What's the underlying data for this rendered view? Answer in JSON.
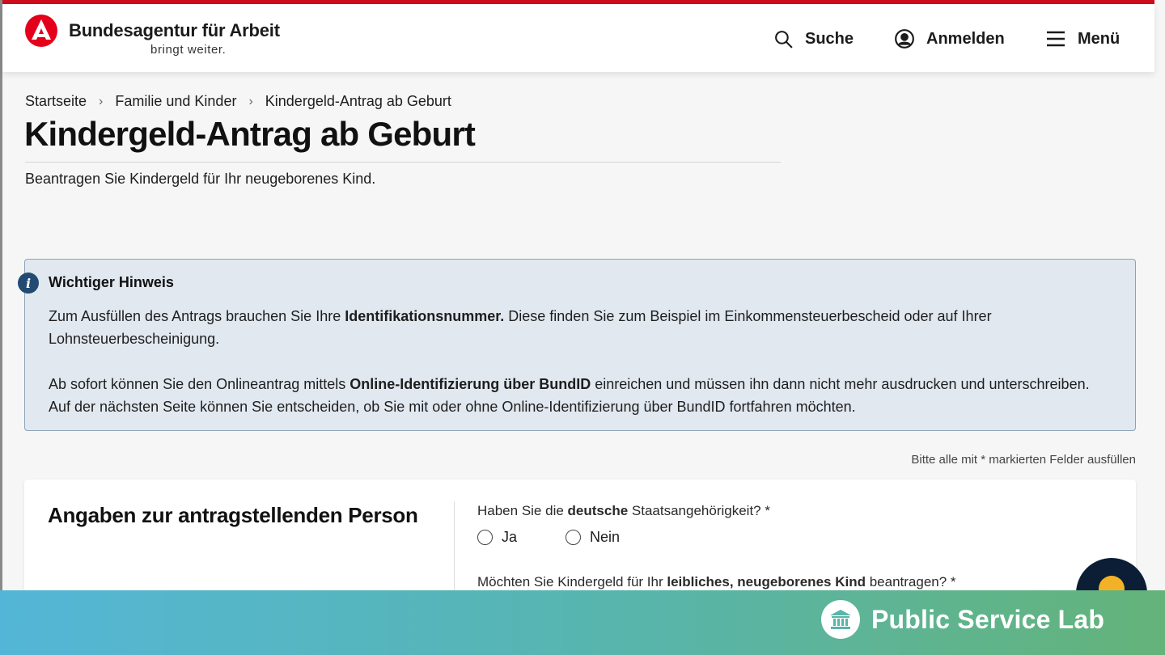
{
  "header": {
    "brand_title": "Bundesagentur für Arbeit",
    "brand_subtitle": "bringt weiter.",
    "nav": {
      "search": "Suche",
      "login": "Anmelden",
      "menu": "Menü"
    },
    "colors": {
      "accent": "#d00d1a"
    }
  },
  "breadcrumb": [
    "Startseite",
    "Familie und Kinder",
    "Kindergeld-Antrag ab Geburt"
  ],
  "page": {
    "title": "Kindergeld-Antrag ab Geburt",
    "subtitle": "Beantragen Sie Kindergeld für Ihr neugeborenes Kind."
  },
  "notice": {
    "title": "Wichtiger Hinweis",
    "p1_pre": "Zum Ausfüllen des Antrags brauchen Sie Ihre ",
    "p1_bold": "Identifikationsnummer.",
    "p1_post": " Diese finden Sie zum Beispiel im Einkommensteuerbescheid oder auf Ihrer Lohnsteuerbescheinigung.",
    "p2_pre": "Ab sofort können Sie den Onlineantrag mittels ",
    "p2_bold": "Online-Identifizierung über BundID",
    "p2_post": " einreichen und müssen ihn dann nicht mehr ausdrucken und unterschreiben. Auf der nächsten Seite können Sie entscheiden, ob Sie mit oder ohne Online-Identifizierung über BundID fortfahren möchten."
  },
  "form": {
    "required_hint": "Bitte alle mit * markierten Felder ausfüllen",
    "section_title": "Angaben zur antragstellenden Person",
    "q1": {
      "pre": "Haben Sie die ",
      "bold": "deutsche",
      "post": " Staatsangehörigkeit? *",
      "options": [
        "Ja",
        "Nein"
      ]
    },
    "q2": {
      "pre": "Möchten Sie Kindergeld für Ihr ",
      "bold": "leibliches, neugeborenes Kind",
      "post": " beantragen? *"
    }
  },
  "footer": {
    "label": "Public Service Lab"
  }
}
